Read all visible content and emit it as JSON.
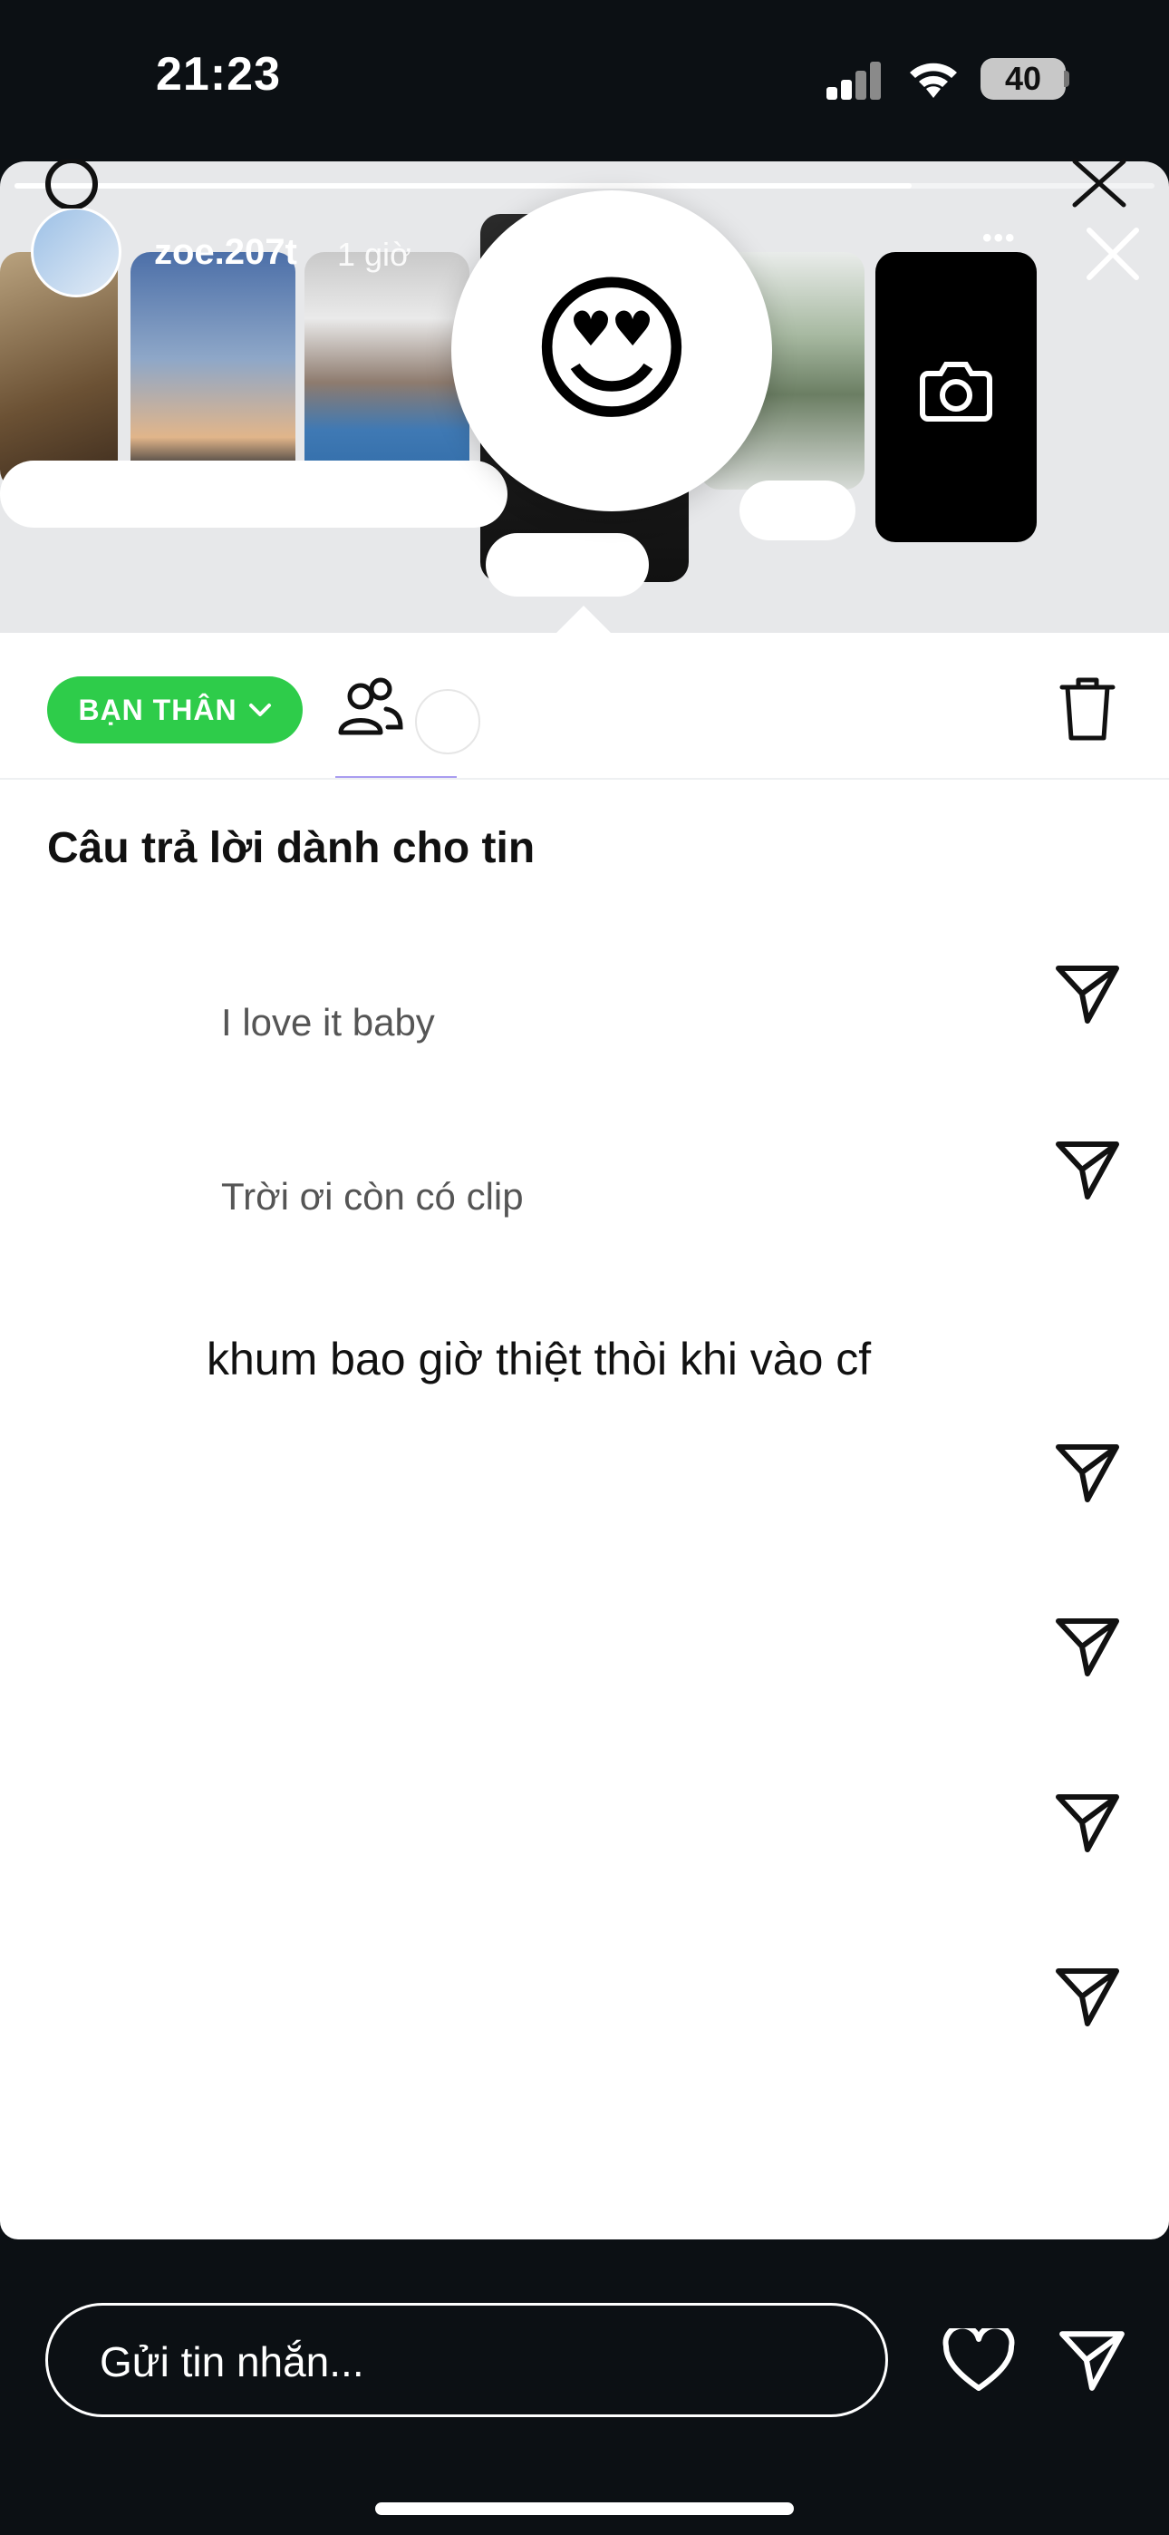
{
  "status_bar": {
    "time": "21:23",
    "battery": "40"
  },
  "story": {
    "username": "zoe.207t",
    "time_ago": "1 giờ",
    "reaction_emoji": "😍",
    "more_label": "•••"
  },
  "sheet": {
    "audience_label": "BẠN THÂN",
    "heading": "Câu trả lời dành cho tin",
    "replies": [
      {
        "text": "I love it baby"
      },
      {
        "text": "Trời ơi còn có clip"
      },
      {
        "text": "khum bao giờ thiệt thòi khi vào cf"
      },
      {
        "text": ""
      },
      {
        "text": ""
      },
      {
        "text": ""
      },
      {
        "text": ""
      }
    ]
  },
  "composer": {
    "placeholder": "Gửi tin nhắn..."
  },
  "colors": {
    "pill": "#2ecc4a",
    "background": "#0c1014",
    "sheet": "#ffffff",
    "accent_tab": "#a99df0"
  }
}
